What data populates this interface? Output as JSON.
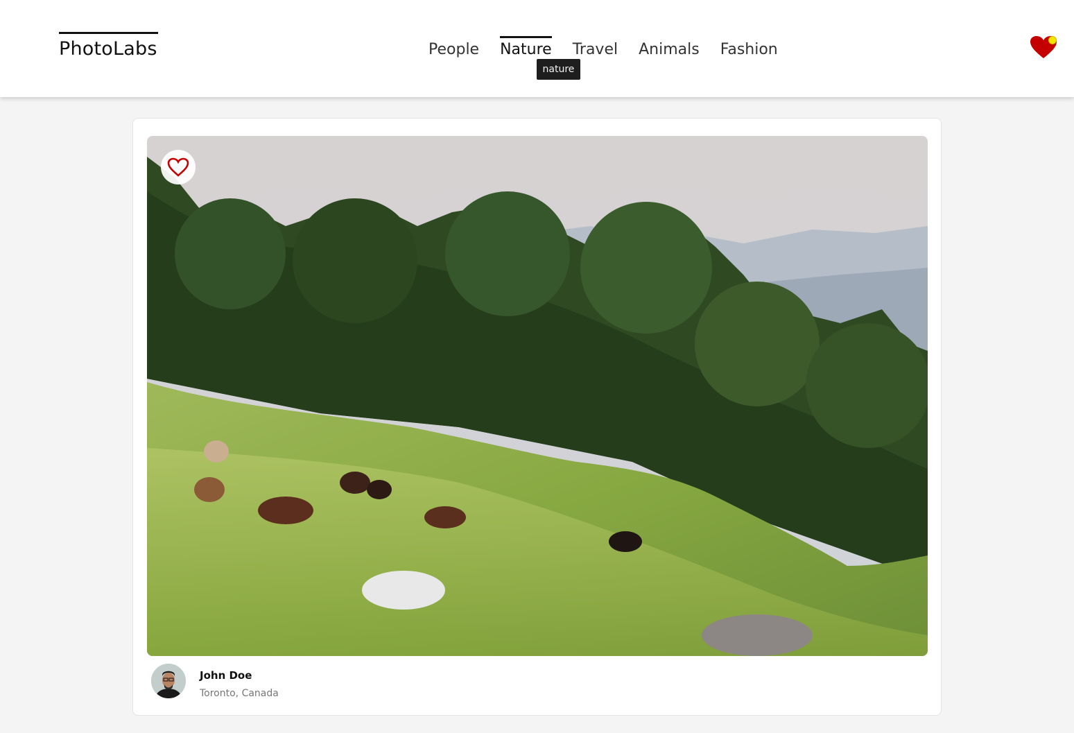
{
  "header": {
    "logo": "PhotoLabs",
    "nav": [
      {
        "label": "People"
      },
      {
        "label": "Nature"
      },
      {
        "label": "Travel"
      },
      {
        "label": "Animals"
      },
      {
        "label": "Fashion"
      }
    ],
    "active_nav": "Nature",
    "tooltip": "nature",
    "favorites_icon": "heart-icon",
    "notification_color": "#f5e400"
  },
  "photo": {
    "like_icon": "heart-outline-icon",
    "user": {
      "name": "John Doe",
      "location": "Toronto, Canada"
    }
  },
  "colors": {
    "heart": "#c40000",
    "page_bg": "#f4f4f4"
  }
}
